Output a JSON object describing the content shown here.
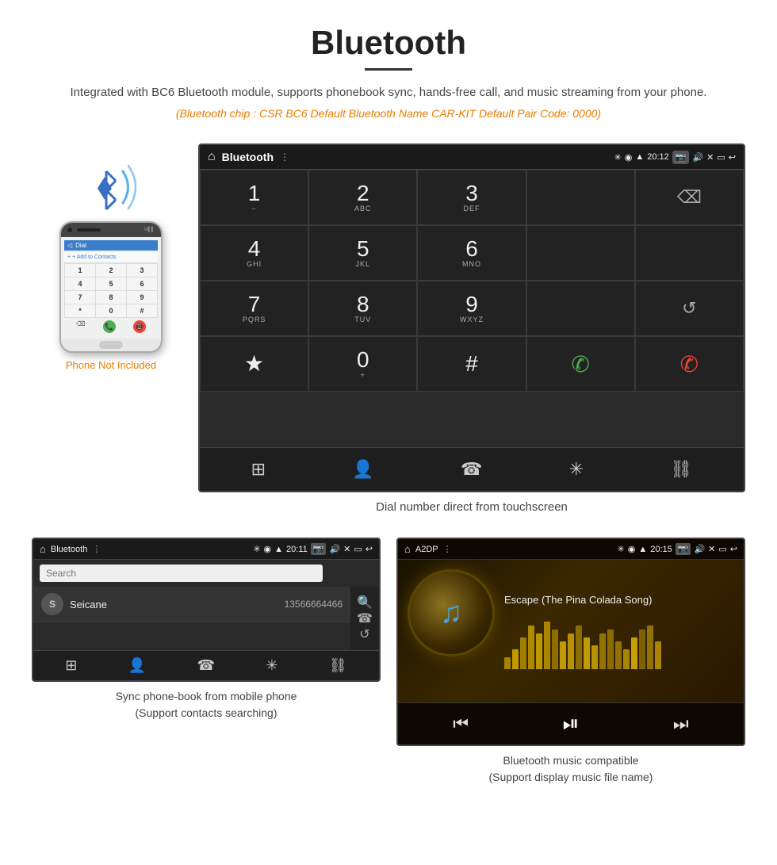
{
  "page": {
    "title": "Bluetooth",
    "subtitle": "Integrated with BC6 Bluetooth module, supports phonebook sync, hands-free call, and music streaming from your phone.",
    "specs": "(Bluetooth chip : CSR BC6    Default Bluetooth Name CAR-KIT    Default Pair Code: 0000)",
    "dial_caption": "Dial number direct from touchscreen",
    "pb_caption_line1": "Sync phone-book from mobile phone",
    "pb_caption_line2": "(Support contacts searching)",
    "music_caption_line1": "Bluetooth music compatible",
    "music_caption_line2": "(Support display music file name)"
  },
  "car_screen": {
    "header_title": "Bluetooth",
    "time": "20:12",
    "usb_icon": "⊕",
    "home_icon": "⌂"
  },
  "dial_keys": [
    {
      "number": "1",
      "letters": "∽∽",
      "sub": ""
    },
    {
      "number": "2",
      "letters": "ABC",
      "sub": ""
    },
    {
      "number": "3",
      "letters": "DEF",
      "sub": ""
    },
    {
      "number": "",
      "letters": "",
      "sub": "empty"
    },
    {
      "number": "⌫",
      "letters": "",
      "sub": "backspace"
    },
    {
      "number": "4",
      "letters": "GHI",
      "sub": ""
    },
    {
      "number": "5",
      "letters": "JKL",
      "sub": ""
    },
    {
      "number": "6",
      "letters": "MNO",
      "sub": ""
    },
    {
      "number": "",
      "letters": "",
      "sub": "empty"
    },
    {
      "number": "",
      "letters": "",
      "sub": "empty"
    },
    {
      "number": "7",
      "letters": "PQRS",
      "sub": ""
    },
    {
      "number": "8",
      "letters": "TUV",
      "sub": ""
    },
    {
      "number": "9",
      "letters": "WXYZ",
      "sub": ""
    },
    {
      "number": "",
      "letters": "",
      "sub": "empty"
    },
    {
      "number": "↺",
      "letters": "",
      "sub": "refresh"
    },
    {
      "number": "★",
      "letters": "",
      "sub": "star"
    },
    {
      "number": "0",
      "letters": "+",
      "sub": "zero"
    },
    {
      "number": "#",
      "letters": "",
      "sub": "hash"
    },
    {
      "number": "call_green",
      "letters": "",
      "sub": "call"
    },
    {
      "number": "call_red",
      "letters": "",
      "sub": "end"
    }
  ],
  "car_bottom_icons": [
    "⊞",
    "⚇",
    "☎",
    "✳",
    "⛓"
  ],
  "pb_screen": {
    "header_title": "Bluetooth",
    "time": "20:11",
    "search_placeholder": "Search",
    "contact": {
      "initial": "S",
      "name": "Seicane",
      "number": "13566664466"
    }
  },
  "music_screen": {
    "header_title": "A2DP",
    "time": "20:15",
    "song_title": "Escape (The Pina Colada Song)",
    "eq_heights": [
      15,
      25,
      40,
      55,
      45,
      60,
      50,
      35,
      45,
      55,
      40,
      30,
      45,
      50,
      35,
      25,
      40,
      50,
      55,
      35
    ]
  },
  "phone_mockup": {
    "add_contact_label": "+ Add to Contacts",
    "keys": [
      "1",
      "2",
      "3",
      "4",
      "5",
      "6",
      "7",
      "8",
      "9",
      "*",
      "0",
      "#"
    ]
  },
  "phone_not_included": "Phone Not Included"
}
